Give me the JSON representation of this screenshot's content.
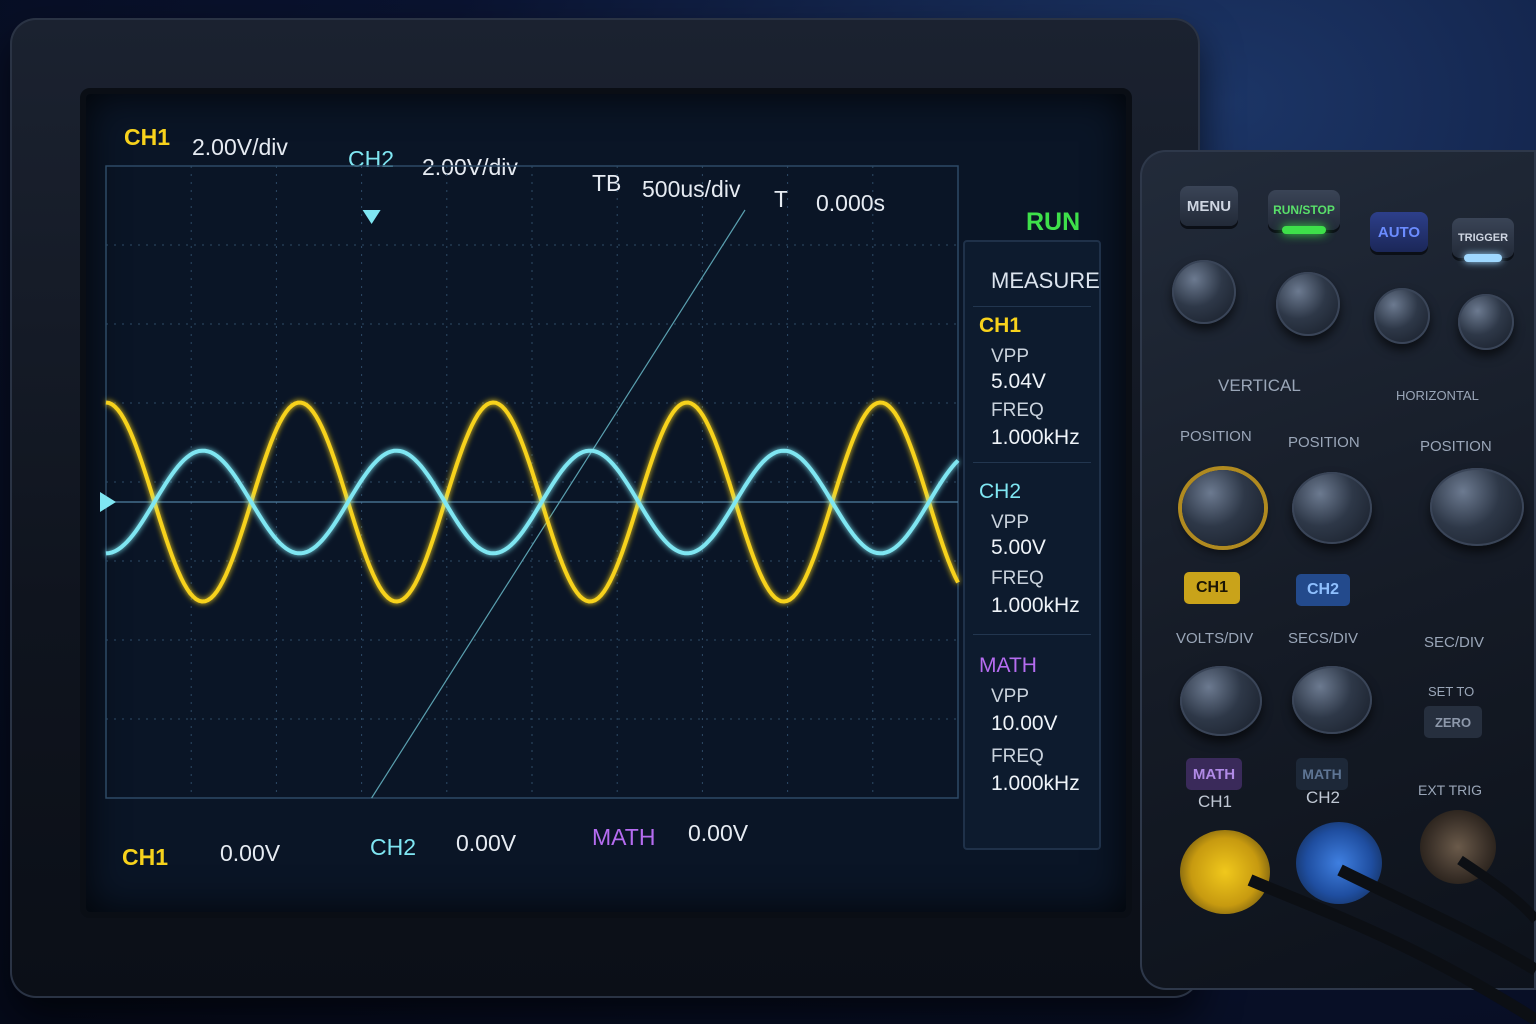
{
  "header": {
    "ch1_label": "CH1",
    "ch1_scale": "2.00V/div",
    "ch2_label": "CH2",
    "ch2_scale": "2.00V/div",
    "tb_label": "TB",
    "tb_value": "500us/div",
    "t_label": "T",
    "t_value": "0.000s",
    "run_status": "RUN"
  },
  "measure": {
    "title": "MEASURE",
    "channels": [
      {
        "name": "CH1",
        "vpp_label": "VPP",
        "vpp": "5.04V",
        "freq_label": "FREQ",
        "freq": "1.000kHz"
      },
      {
        "name": "CH2",
        "vpp_label": "VPP",
        "vpp": "5.00V",
        "freq_label": "FREQ",
        "freq": "1.000kHz"
      },
      {
        "name": "MATH",
        "vpp_label": "VPP",
        "vpp": "10.00V",
        "freq_label": "FREQ",
        "freq": "1.000kHz"
      }
    ]
  },
  "footer": {
    "ch1_label": "CH1",
    "ch1_offset": "0.00V",
    "ch2_label": "CH2",
    "ch2_offset": "0.00V",
    "math_label": "MATH",
    "math_offset": "0.00V"
  },
  "panel": {
    "menu": "MENU",
    "run_stop": "RUN/STOP",
    "auto": "AUTO",
    "trigger": "TRIGGER",
    "vertical": "VERTICAL",
    "horizontal": "HORIZONTAL",
    "position_1": "POSITION",
    "position_2": "POSITION",
    "position_h": "POSITION",
    "ch1_btn": "CH1",
    "ch2_btn": "CH2",
    "volts_div": "VOLTS/DIV",
    "secs_div_1": "SECS/DIV",
    "secs_div_2": "SEC/DIV",
    "set_to": "SET TO",
    "zero": "ZERO",
    "math_btn": "MATH",
    "math2_btn": "MATH",
    "ch1_input": "CH1",
    "ch2_input": "CH2",
    "ext_trig": "EXT TRIG"
  },
  "colors": {
    "ch1": "#f7d21c",
    "ch2": "#7fe6f2",
    "math": "#b56cf0",
    "run": "#3ee04a",
    "grid": "#2d4a66",
    "screen": "#0a1526"
  },
  "chart_data": {
    "type": "line",
    "title": "",
    "xlabel": "",
    "ylabel": "",
    "x_divisions": 10,
    "y_divisions": 8,
    "time_per_div": "500us/div",
    "volts_per_div": "2.00V/div",
    "grid": true,
    "series": [
      {
        "name": "CH1",
        "color": "#f7d21c",
        "waveform": "sine",
        "amplitude_div": 1.26,
        "cycles_on_screen": 4.4,
        "phase_deg": 90
      },
      {
        "name": "CH2",
        "color": "#7fe6f2",
        "waveform": "sine",
        "amplitude_div": 0.65,
        "cycles_on_screen": 4.4,
        "phase_deg": 270
      }
    ]
  }
}
